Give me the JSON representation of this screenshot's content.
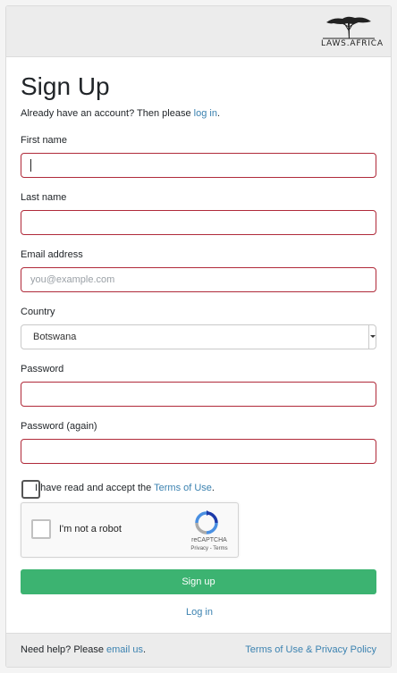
{
  "brand": {
    "logo_text": "LAWS.AFRICA"
  },
  "form": {
    "title": "Sign Up",
    "already_prefix": "Already have an account? Then please ",
    "already_link": "log in",
    "already_suffix": ".",
    "first_name": {
      "label": "First name",
      "value": "",
      "placeholder": ""
    },
    "last_name": {
      "label": "Last name",
      "value": "",
      "placeholder": ""
    },
    "email": {
      "label": "Email address",
      "value": "",
      "placeholder": "you@example.com"
    },
    "country": {
      "label": "Country",
      "selected": "Botswana"
    },
    "password": {
      "label": "Password",
      "value": ""
    },
    "password_again": {
      "label": "Password (again)",
      "value": ""
    },
    "terms": {
      "prefix": "I have read and accept the ",
      "link": "Terms of Use",
      "suffix": ".",
      "checked": false
    },
    "recaptcha": {
      "label": "I'm not a robot",
      "brand": "reCAPTCHA",
      "links": "Privacy - Terms"
    },
    "submit_label": "Sign up",
    "login_label": "Log in"
  },
  "footer": {
    "help_prefix": "Need help? Please ",
    "help_link": "email us",
    "help_suffix": ".",
    "policy_link": "Terms of Use & Privacy Policy"
  },
  "colors": {
    "accent": "#3b82b0",
    "submit": "#3cb371",
    "invalid_border": "#b02a3a"
  }
}
